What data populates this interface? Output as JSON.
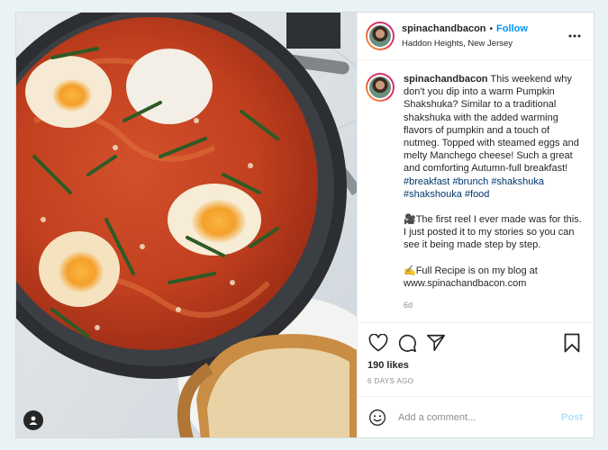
{
  "header": {
    "username": "spinachandbacon",
    "separator": "•",
    "follow_label": "Follow",
    "location": "Haddon Heights, New Jersey"
  },
  "caption": {
    "username": "spinachandbacon",
    "text": "This weekend why don't you dip into a warm Pumpkin Shakshuka? Similar to a traditional shakshuka with the added warming flavors of pumpkin and a touch of nutmeg. Topped with steamed eggs and melty Manchego cheese! Such a great and comforting Autumn-full breakfast!",
    "hashtags": [
      "#breakfast",
      "#brunch",
      "#shakshuka",
      "#shakshouka",
      "#food"
    ],
    "para2": "🎥The first reel I ever made was for this. I just posted it to my stories so you can see it being made step by step.",
    "para3": "✍️Full Recipe is on my blog at www.spinachandbacon.com",
    "time_ago": "6d"
  },
  "likes": "190 likes",
  "date": "6 DAYS AGO",
  "comment_box": {
    "placeholder": "Add a comment...",
    "post_label": "Post"
  },
  "icons": {
    "more": "more-horizontal-icon",
    "like": "heart-icon",
    "comment": "comment-bubble-icon",
    "share": "paper-plane-icon",
    "save": "bookmark-icon",
    "emoji": "smiley-icon",
    "tag": "user-tag-icon"
  },
  "colors": {
    "follow": "#0095f6",
    "hashtag": "#00376b",
    "post_disabled": "#b2dffc",
    "page_bg": "#e9f3f6"
  }
}
